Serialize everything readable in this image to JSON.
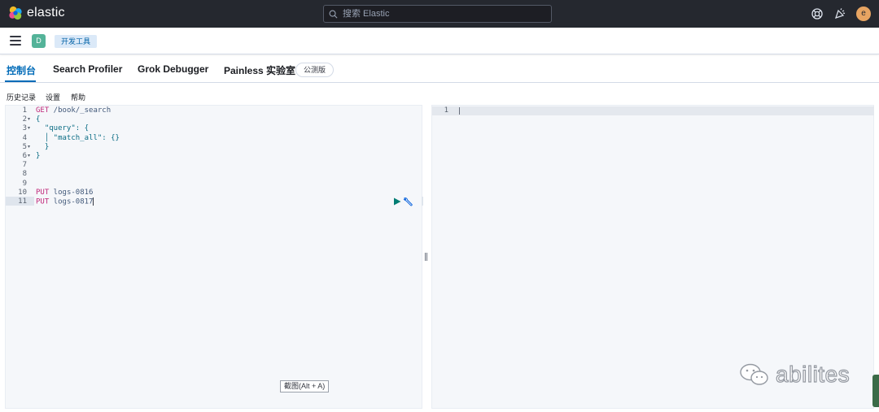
{
  "header": {
    "app_name": "elastic",
    "search_placeholder": "搜索 Elastic",
    "icons": [
      "help-icon",
      "newsfeed-icon"
    ],
    "user_initial": "e",
    "colors": {
      "header_bg": "#25282f",
      "accent": "#006bb8",
      "avatar": "#e7a462"
    }
  },
  "subheader": {
    "space_initial": "D",
    "breadcrumb": "开发工具"
  },
  "tabs": [
    {
      "label": "控制台",
      "active": true
    },
    {
      "label": "Search Profiler",
      "active": false
    },
    {
      "label": "Grok Debugger",
      "active": false
    },
    {
      "label": "Painless 实验室",
      "active": false
    }
  ],
  "beta_badge": "公测版",
  "toolbar": [
    "历史记录",
    "设置",
    "帮助"
  ],
  "editor": {
    "lines": [
      {
        "n": "1",
        "fold": "",
        "method": "GET",
        "rest": " /book/_search"
      },
      {
        "n": "2",
        "fold": "▾",
        "method": "",
        "rest": "{"
      },
      {
        "n": "3",
        "fold": "▾",
        "method": "",
        "rest": "  \"query\": {"
      },
      {
        "n": "4",
        "fold": "",
        "method": "",
        "rest": "  │ \"match_all\": {}"
      },
      {
        "n": "5",
        "fold": "▾",
        "method": "",
        "rest": "  }"
      },
      {
        "n": "6",
        "fold": "▾",
        "method": "",
        "rest": "}"
      },
      {
        "n": "7",
        "fold": "",
        "method": "",
        "rest": ""
      },
      {
        "n": "8",
        "fold": "",
        "method": "",
        "rest": ""
      },
      {
        "n": "9",
        "fold": "",
        "method": "",
        "rest": ""
      },
      {
        "n": "10",
        "fold": "",
        "method": "PUT",
        "rest": " logs-0816"
      },
      {
        "n": "11",
        "fold": "",
        "method": "PUT",
        "rest": " logs-0817"
      }
    ],
    "active_line": "11"
  },
  "output": {
    "line_number": "1"
  },
  "tooltip": "截图(Alt + A)",
  "watermark": "abilites"
}
